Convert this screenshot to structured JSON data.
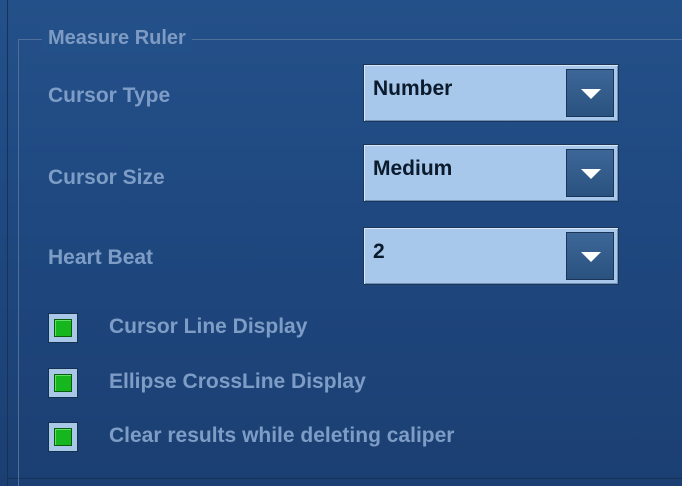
{
  "group": {
    "title": "Measure Ruler"
  },
  "fields": [
    {
      "label": "Cursor Type",
      "value": "Number"
    },
    {
      "label": "Cursor Size",
      "value": "Medium"
    },
    {
      "label": "Heart Beat",
      "value": "2"
    }
  ],
  "checkboxes": [
    {
      "label": "Cursor Line Display",
      "checked": true
    },
    {
      "label": "Ellipse CrossLine Display",
      "checked": true
    },
    {
      "label": "Clear results while deleting caliper",
      "checked": true
    }
  ],
  "icons": {
    "dropdown_arrow": "chevron-down-icon",
    "check_mark": "check-icon"
  },
  "colors": {
    "background": "#245089",
    "label_text": "#7e9dc6",
    "dropdown_face": "#a7c8ea",
    "check_fill": "#15b61e"
  }
}
